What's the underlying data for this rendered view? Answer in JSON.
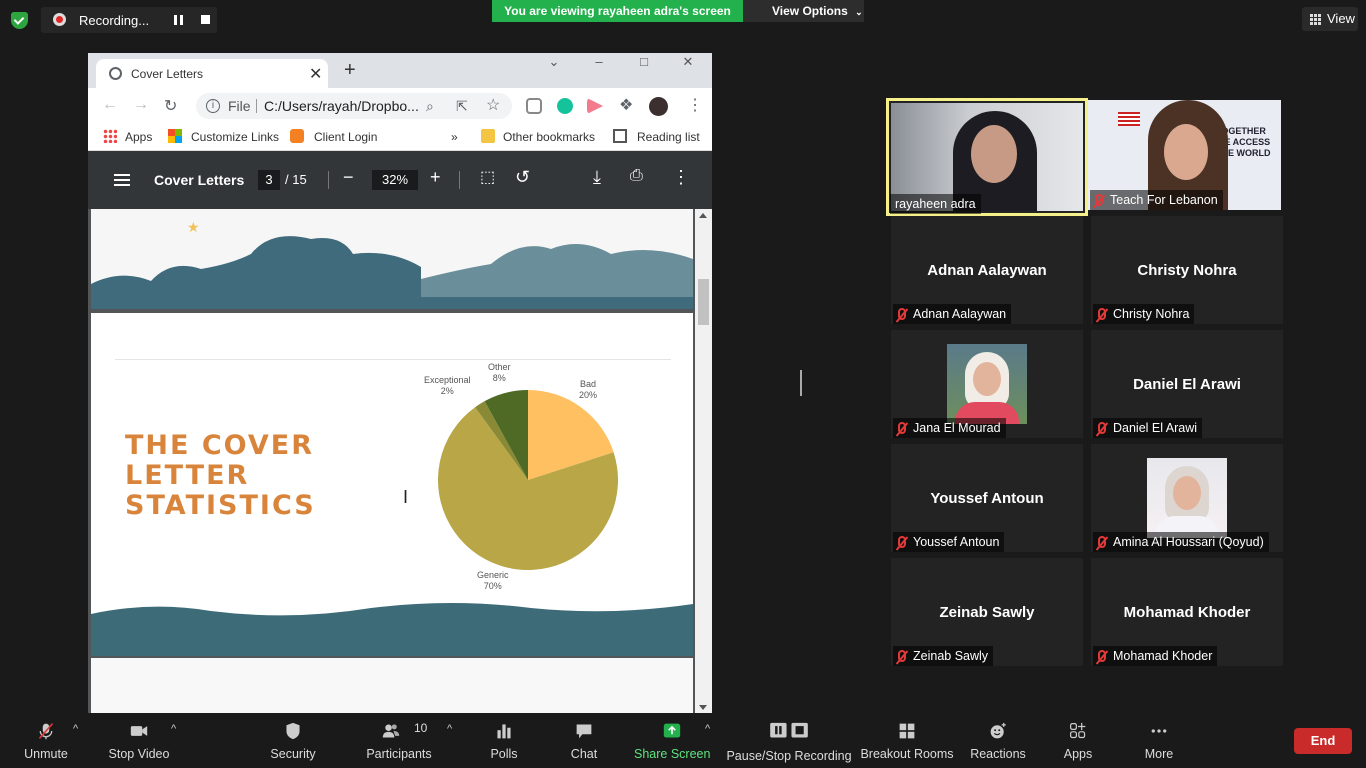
{
  "topbar": {
    "recording_text": "Recording...",
    "viewing_banner": "You are viewing rayaheen adra's screen",
    "view_options": "View Options",
    "view_label": "View"
  },
  "browser": {
    "tab_title": "Cover Letters",
    "new_tab": "+",
    "url_scheme": "File",
    "url": "C:/Users/rayah/Dropbo...",
    "bookmarks": [
      "Apps",
      "Customize Links",
      "Client Login",
      "»",
      "Other bookmarks",
      "Reading list"
    ]
  },
  "pdf": {
    "title": "Cover Letters",
    "page_current": "3",
    "page_total": "/ 15",
    "zoom": "32%",
    "slide_title": "THE COVER LETTER STATISTICS"
  },
  "chart_data": {
    "type": "pie",
    "categories": [
      "Bad",
      "Generic",
      "Exceptional",
      "Other"
    ],
    "values": [
      20,
      70,
      2,
      8
    ],
    "labels": [
      "20%",
      "70%",
      "2%",
      "8%"
    ],
    "colors": [
      "#ffc061",
      "#b8a647",
      "#8a8a36",
      "#4e6a25"
    ]
  },
  "participants": [
    {
      "name": "rayaheen adra",
      "video": true,
      "active": true,
      "muted": false
    },
    {
      "name": "Teach For Lebanon",
      "video": true,
      "active": false,
      "muted": true
    },
    {
      "name": "Adnan Aalaywan",
      "video": false,
      "muted": true
    },
    {
      "name": "Christy Nohra",
      "video": false,
      "muted": true
    },
    {
      "name": "Jana El Mourad",
      "video": true,
      "muted": true
    },
    {
      "name": "Daniel El Arawi",
      "video": false,
      "muted": true
    },
    {
      "name": "Youssef Antoun",
      "video": false,
      "muted": true
    },
    {
      "name": "Amina Al Houssari (Qoyud)",
      "video": true,
      "muted": true
    },
    {
      "name": "Zeinab Sawly",
      "video": false,
      "muted": true
    },
    {
      "name": "Mohamad Khoder",
      "video": false,
      "muted": true
    }
  ],
  "controls": {
    "unmute": "Unmute",
    "stop_video": "Stop Video",
    "security": "Security",
    "participants": "Participants",
    "participants_count": "10",
    "polls": "Polls",
    "chat": "Chat",
    "share_screen": "Share Screen",
    "pause_recording": "Pause/Stop Recording",
    "breakout_rooms": "Breakout Rooms",
    "reactions": "Reactions",
    "apps": "Apps",
    "more": "More",
    "end": "End"
  },
  "colors": {
    "share_green": "#22b14c",
    "end_red": "#c92a2a",
    "active_speaker": "#f5f08a",
    "pdf_toolbar": "#323639",
    "slide_accent": "#d9843b"
  }
}
